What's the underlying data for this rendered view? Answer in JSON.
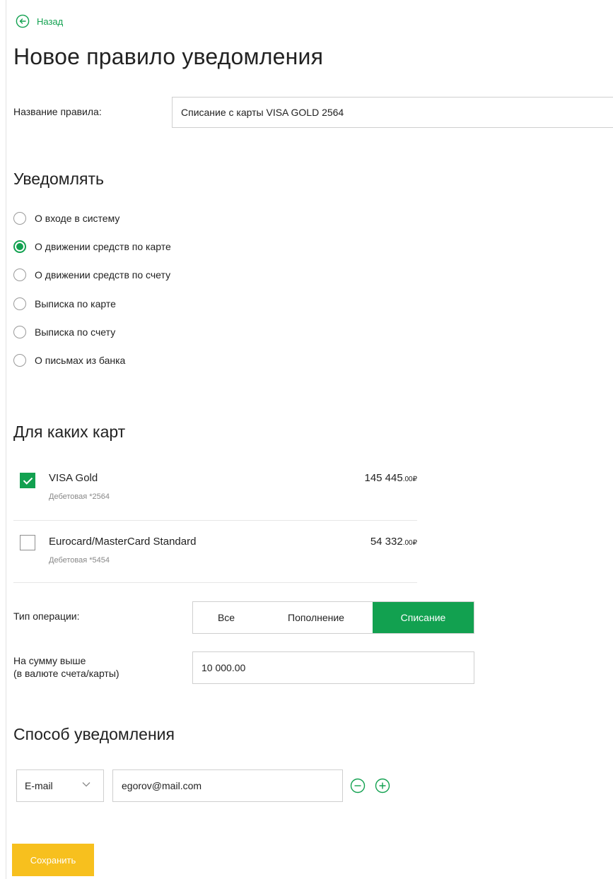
{
  "back": {
    "label": "Назад",
    "icon": "arrow-left-circle-icon"
  },
  "title": "Новое правило уведомления",
  "rule_name": {
    "label": "Название правила:",
    "value": "Списание с карты VISA GOLD 2564"
  },
  "notify": {
    "title": "Уведомлять",
    "options": [
      {
        "label": "О входе в систему",
        "checked": false
      },
      {
        "label": "О движении средств по карте",
        "checked": true
      },
      {
        "label": "О движении средств по счету",
        "checked": false
      },
      {
        "label": "Выписка по карте",
        "checked": false
      },
      {
        "label": "Выписка по счету",
        "checked": false
      },
      {
        "label": "О письмах из банка",
        "checked": false
      }
    ]
  },
  "cards": {
    "title": "Для каких карт",
    "items": [
      {
        "name": "VISA Gold",
        "sub": "Дебетовая *2564",
        "amount": "145 445",
        "cents": ".00",
        "currency": "₽",
        "checked": true
      },
      {
        "name": "Eurocard/MasterCard Standard",
        "sub": "Дебетовая *5454",
        "amount": "54 332",
        "cents": ".00",
        "currency": "₽",
        "checked": false
      }
    ]
  },
  "operation": {
    "label": "Тип операции:",
    "options": [
      "Все",
      "Пополнение",
      "Списание"
    ],
    "active": "Списание"
  },
  "amount": {
    "label_line1": "На сумму выше",
    "label_line2": "(в валюте счета/карты)",
    "value": "10 000.00"
  },
  "method": {
    "title": "Способ уведомления",
    "channel": "E-mail",
    "address": "egorov@mail.com",
    "remove_icon": "minus-circle-icon",
    "add_icon": "plus-circle-icon"
  },
  "save_label": "Сохранить",
  "colors": {
    "accent": "#12a150",
    "save": "#f7c01e",
    "border": "#cfcfcf",
    "muted": "#888888"
  }
}
